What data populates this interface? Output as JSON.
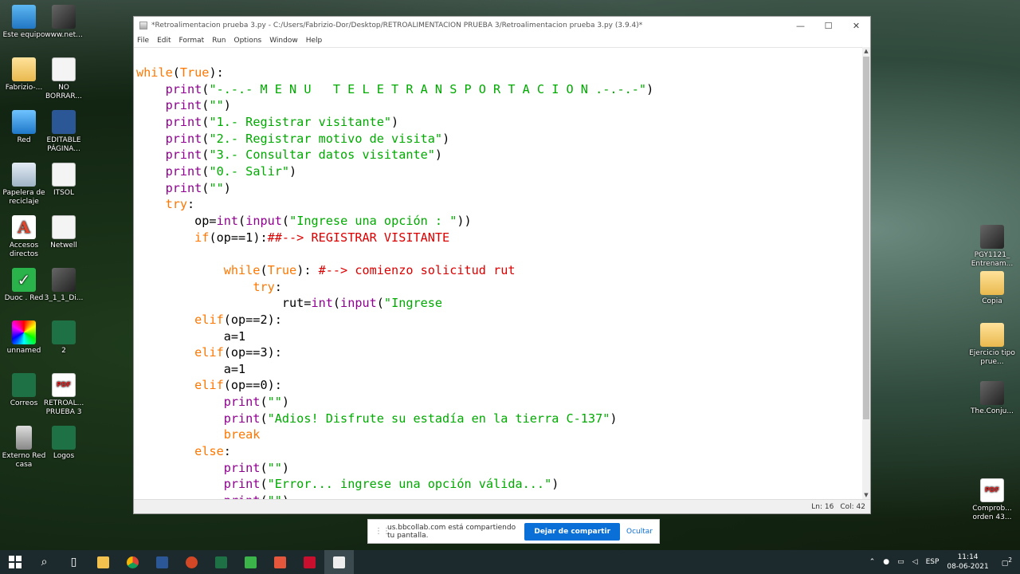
{
  "desktop_left": [
    {
      "label": "Este equipo",
      "icon": "computer-icon"
    },
    {
      "label": "www.net...",
      "icon": "winrar-icon"
    },
    {
      "label": "Fabrizio-...",
      "icon": "user-folder-icon"
    },
    {
      "label": "NO BORRAR...",
      "icon": "document-icon"
    },
    {
      "label": "Red",
      "icon": "network-icon"
    },
    {
      "label": "EDITABLE PÁGINA...",
      "icon": "word-icon"
    },
    {
      "label": "Papelera de reciclaje",
      "icon": "recycle-bin-icon"
    },
    {
      "label": "ITSOL",
      "icon": "document-icon"
    },
    {
      "label": "Accesos directos",
      "icon": "accesos-icon"
    },
    {
      "label": "Netwell",
      "icon": "document-icon"
    },
    {
      "label": "Duoc . Red",
      "icon": "check-icon"
    },
    {
      "label": "3_1_1_Di...",
      "icon": "image-icon"
    },
    {
      "label": "unnamed",
      "icon": "color-wheel-icon"
    },
    {
      "label": "2",
      "icon": "excel-icon"
    },
    {
      "label": "Correos",
      "icon": "excel-icon"
    },
    {
      "label": "RETROAL... PRUEBA 3",
      "icon": "pdf-icon"
    },
    {
      "label": "Externo Red casa",
      "icon": "drive-icon"
    },
    {
      "label": "Logos",
      "icon": "excel-icon"
    }
  ],
  "desktop_right": [
    {
      "label": "PGY1121_ Entrenam...",
      "icon": "image-icon"
    },
    {
      "label": "Copia",
      "icon": "folder-icon"
    },
    {
      "label": "Ejercicio tipo prue...",
      "icon": "folder-icon"
    },
    {
      "label": "The.Conju...",
      "icon": "image-icon"
    },
    {
      "label": "Comprob... orden 43...",
      "icon": "pdf-icon"
    }
  ],
  "window": {
    "title": "*Retroalimentacion prueba 3.py - C:/Users/Fabrizio-Dor/Desktop/RETROALIMENTACION PRUEBA 3/Retroalimentacion prueba 3.py (3.9.4)*",
    "minimize": "—",
    "maximize": "☐",
    "close": "✕"
  },
  "menu": [
    "File",
    "Edit",
    "Format",
    "Run",
    "Options",
    "Window",
    "Help"
  ],
  "code_lines": [
    [
      [
        "kw",
        "while"
      ],
      [
        "",
        "("
      ],
      [
        "kw",
        "True"
      ],
      [
        "",
        "):"
      ]
    ],
    [
      [
        "",
        "    "
      ],
      [
        "bi",
        "print"
      ],
      [
        "",
        "("
      ],
      [
        "st",
        "\"-.-.- M E N U   T E L E T R A N S P O R T A C I O N .-.-.-\""
      ],
      [
        "",
        ")"
      ]
    ],
    [
      [
        "",
        "    "
      ],
      [
        "bi",
        "print"
      ],
      [
        "",
        "("
      ],
      [
        "st",
        "\"\""
      ],
      [
        "",
        ")"
      ]
    ],
    [
      [
        "",
        "    "
      ],
      [
        "bi",
        "print"
      ],
      [
        "",
        "("
      ],
      [
        "st",
        "\"1.- Registrar visitante\""
      ],
      [
        "",
        ")"
      ]
    ],
    [
      [
        "",
        "    "
      ],
      [
        "bi",
        "print"
      ],
      [
        "",
        "("
      ],
      [
        "st",
        "\"2.- Registrar motivo de visita\""
      ],
      [
        "",
        ")"
      ]
    ],
    [
      [
        "",
        "    "
      ],
      [
        "bi",
        "print"
      ],
      [
        "",
        "("
      ],
      [
        "st",
        "\"3.- Consultar datos visitante\""
      ],
      [
        "",
        ")"
      ]
    ],
    [
      [
        "",
        "    "
      ],
      [
        "bi",
        "print"
      ],
      [
        "",
        "("
      ],
      [
        "st",
        "\"0.- Salir\""
      ],
      [
        "",
        ")"
      ]
    ],
    [
      [
        "",
        "    "
      ],
      [
        "bi",
        "print"
      ],
      [
        "",
        "("
      ],
      [
        "st",
        "\"\""
      ],
      [
        "",
        ")"
      ]
    ],
    [
      [
        "",
        "    "
      ],
      [
        "kw",
        "try"
      ],
      [
        "",
        ":"
      ]
    ],
    [
      [
        "",
        "        op="
      ],
      [
        "bi",
        "int"
      ],
      [
        "",
        "("
      ],
      [
        "bi",
        "input"
      ],
      [
        "",
        "("
      ],
      [
        "st",
        "\"Ingrese una opción : \""
      ],
      [
        "",
        "))"
      ]
    ],
    [
      [
        "",
        "        "
      ],
      [
        "kw",
        "if"
      ],
      [
        "",
        "(op==1):"
      ],
      [
        "cm",
        "##--> REGISTRAR VISITANTE"
      ]
    ],
    [
      [
        "",
        ""
      ]
    ],
    [
      [
        "",
        "            "
      ],
      [
        "kw",
        "while"
      ],
      [
        "",
        "("
      ],
      [
        "kw",
        "True"
      ],
      [
        "",
        "): "
      ],
      [
        "cm",
        "#--> comienzo solicitud rut"
      ]
    ],
    [
      [
        "",
        "                "
      ],
      [
        "kw",
        "try"
      ],
      [
        "",
        ":"
      ]
    ],
    [
      [
        "",
        "                    rut="
      ],
      [
        "bi",
        "int"
      ],
      [
        "",
        "("
      ],
      [
        "bi",
        "input"
      ],
      [
        "",
        "("
      ],
      [
        "st",
        "\"Ingrese"
      ]
    ],
    [
      [
        "",
        "        "
      ],
      [
        "kw",
        "elif"
      ],
      [
        "",
        "(op==2):"
      ]
    ],
    [
      [
        "",
        "            a=1"
      ]
    ],
    [
      [
        "",
        "        "
      ],
      [
        "kw",
        "elif"
      ],
      [
        "",
        "(op==3):"
      ]
    ],
    [
      [
        "",
        "            a=1"
      ]
    ],
    [
      [
        "",
        "        "
      ],
      [
        "kw",
        "elif"
      ],
      [
        "",
        "(op==0):"
      ]
    ],
    [
      [
        "",
        "            "
      ],
      [
        "bi",
        "print"
      ],
      [
        "",
        "("
      ],
      [
        "st",
        "\"\""
      ],
      [
        "",
        ")"
      ]
    ],
    [
      [
        "",
        "            "
      ],
      [
        "bi",
        "print"
      ],
      [
        "",
        "("
      ],
      [
        "st",
        "\"Adios! Disfrute su estadía en la tierra C-137\""
      ],
      [
        "",
        ")"
      ]
    ],
    [
      [
        "",
        "            "
      ],
      [
        "kw",
        "break"
      ]
    ],
    [
      [
        "",
        "        "
      ],
      [
        "kw",
        "else"
      ],
      [
        "",
        ":"
      ]
    ],
    [
      [
        "",
        "            "
      ],
      [
        "bi",
        "print"
      ],
      [
        "",
        "("
      ],
      [
        "st",
        "\"\""
      ],
      [
        "",
        ")"
      ]
    ],
    [
      [
        "",
        "            "
      ],
      [
        "bi",
        "print"
      ],
      [
        "",
        "("
      ],
      [
        "st",
        "\"Error... ingrese una opción válida...\""
      ],
      [
        "",
        ")"
      ]
    ],
    [
      [
        "",
        "            "
      ],
      [
        "bi",
        "print"
      ],
      [
        "",
        "("
      ],
      [
        "st",
        "\"\""
      ],
      [
        "",
        ")"
      ]
    ]
  ],
  "status": {
    "line": "Ln: 16",
    "col": "Col: 42"
  },
  "share": {
    "text": "us.bbcollab.com está compartiendo tu pantalla.",
    "stop_label": "Dejar de compartir",
    "hide_label": "Ocultar"
  },
  "taskbar": {
    "apps": [
      "windows-start-icon",
      "search-icon",
      "task-view-icon",
      "file-explorer-icon",
      "chrome-icon",
      "word-icon",
      "powerpoint-icon",
      "excel-icon",
      "camtasia-icon",
      "recorder-icon",
      "acrobat-icon",
      "idle-icon"
    ],
    "language": "ESP",
    "time": "11:14",
    "date": "08-06-2021",
    "notifications": "2"
  }
}
